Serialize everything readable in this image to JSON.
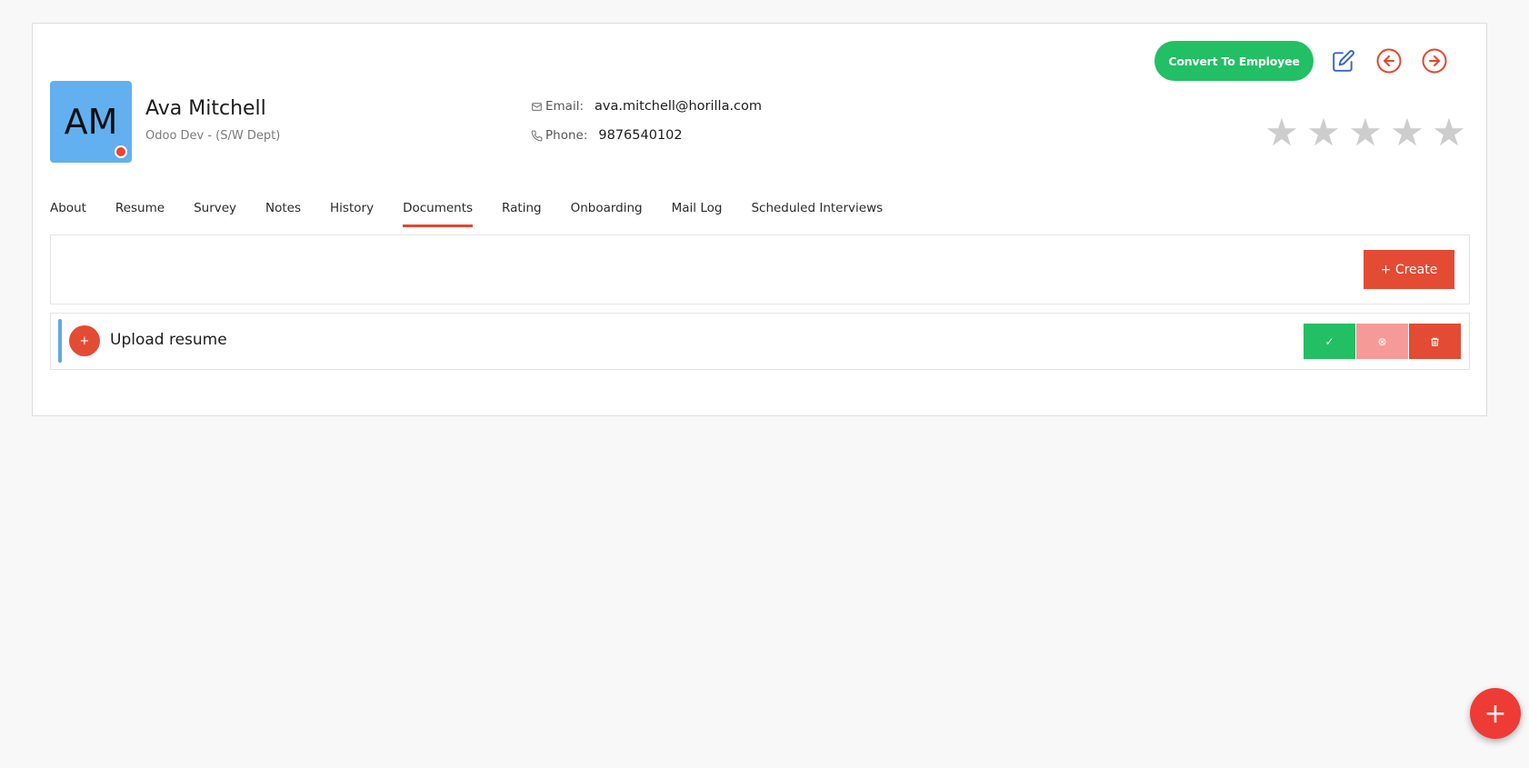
{
  "header": {
    "convert_label": "Convert To Employee",
    "avatar_initials": "AM",
    "name": "Ava Mitchell",
    "subtitle": "Odoo Dev - (S/W Dept)",
    "email_label": "Email:",
    "email": "ava.mitchell@horilla.com",
    "phone_label": "Phone:",
    "phone": "9876540102",
    "rating": 0,
    "rating_max": 5
  },
  "tabs": [
    {
      "label": "About"
    },
    {
      "label": "Resume"
    },
    {
      "label": "Survey"
    },
    {
      "label": "Notes"
    },
    {
      "label": "History"
    },
    {
      "label": "Documents",
      "active": true
    },
    {
      "label": "Rating"
    },
    {
      "label": "Onboarding"
    },
    {
      "label": "Mail Log"
    },
    {
      "label": "Scheduled Interviews"
    }
  ],
  "documents": {
    "create_label": "+ Create",
    "items": [
      {
        "plus": "+",
        "title": "Upload resume"
      }
    ]
  },
  "icons": {
    "approve": "✓",
    "reject": "⊗",
    "delete": "🗑",
    "fab": "+"
  },
  "colors": {
    "accent": "#e8442d",
    "success": "#22bf64",
    "avatar": "#62b0f0"
  }
}
